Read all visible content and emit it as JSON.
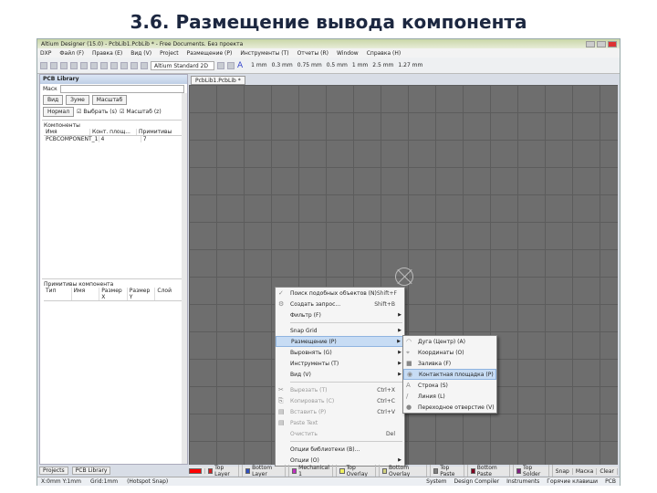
{
  "slide_title": "3.6. Размещение вывода компонента",
  "window_title": "Altium Designer (15.0) - PcbLib1.PcbLib * - Free Documents. Без проекта",
  "menu": [
    "DXP",
    "Файл (F)",
    "Правка (E)",
    "Вид (V)",
    "Project",
    "Размещение (P)",
    "Инструменты (T)",
    "Отчеты (R)",
    "Window",
    "Справка (H)"
  ],
  "toolbar": {
    "combo": "Altium Standard 2D",
    "units": [
      "1 mm",
      "0.3 mm",
      "0.75 mm",
      "0.5 mm",
      "1 mm",
      "2.5 mm",
      "1.27 mm"
    ]
  },
  "panel": {
    "title": "PCB Library",
    "mask_label": "Маск",
    "buttons": [
      "Вид",
      "Зуме",
      "Масштаб"
    ],
    "mode": "Нормал",
    "check1": "Выбрать (s)",
    "check2": "Масштаб (z)",
    "components": {
      "title": "Компоненты",
      "headers": [
        "Имя",
        "Конт. площ...",
        "Примитивы"
      ],
      "rows": [
        {
          "name": "PCBCOMPONENT_1",
          "pads": "4",
          "prims": "7"
        }
      ]
    },
    "primitives": {
      "title": "Примитивы компонента",
      "headers": [
        "Тип",
        "Имя",
        "Размер X",
        "Размер Y",
        "Слой"
      ]
    },
    "tabs": [
      "Projects",
      "PCB Library"
    ]
  },
  "doc_tab": "PcbLib1.PcbLib *",
  "context_menu": [
    {
      "label": "Поиск подобных объектов (N)",
      "shortcut": "Shift+F",
      "icon": "✓"
    },
    {
      "label": "Создать запрос...",
      "shortcut": "Shift+B",
      "icon": "⚙"
    },
    {
      "label": "Фильтр (F)",
      "sub": true
    },
    {
      "sep": true
    },
    {
      "label": "Snap Grid",
      "sub": true
    },
    {
      "label": "Размещение (P)",
      "sub": true,
      "hl": true
    },
    {
      "label": "Выровнять (G)",
      "sub": true
    },
    {
      "label": "Инструменты (T)",
      "sub": true
    },
    {
      "label": "Вид (V)",
      "sub": true
    },
    {
      "sep": true
    },
    {
      "label": "Вырезать (T)",
      "shortcut": "Ctrl+X",
      "dis": true,
      "icon": "✂"
    },
    {
      "label": "Копировать (C)",
      "shortcut": "Ctrl+C",
      "dis": true,
      "icon": "⎘"
    },
    {
      "label": "Вставить (P)",
      "shortcut": "Ctrl+V",
      "dis": true,
      "icon": "▤"
    },
    {
      "label": "Paste Text",
      "dis": true,
      "icon": "▤"
    },
    {
      "label": "Очистить",
      "shortcut": "Del",
      "dis": true
    },
    {
      "sep": true
    },
    {
      "label": "Опции библиотеки (B)..."
    },
    {
      "label": "Опции (O)",
      "sub": true
    }
  ],
  "submenu": [
    {
      "label": "Дуга (Центр) (A)",
      "icon": "◠"
    },
    {
      "label": "Координаты (O)",
      "icon": "⌖"
    },
    {
      "label": "Заливка (F)",
      "icon": "■"
    },
    {
      "label": "Контактная площадка (P)",
      "icon": "◉",
      "hl": true
    },
    {
      "label": "Строка (S)",
      "icon": "A"
    },
    {
      "label": "Линия (L)",
      "icon": "/"
    },
    {
      "label": "Переходное отверстие (V)",
      "icon": "●"
    }
  ],
  "layers": [
    {
      "name": "Top Layer",
      "color": "#d02020"
    },
    {
      "name": "Bottom Layer",
      "color": "#3050c0"
    },
    {
      "name": "Mechanical 1",
      "color": "#c030c0"
    },
    {
      "name": "Top Overlay",
      "color": "#f0f060"
    },
    {
      "name": "Bottom Overlay",
      "color": "#d0d080"
    },
    {
      "name": "Top Paste",
      "color": "#808080"
    },
    {
      "name": "Bottom Paste",
      "color": "#800020"
    },
    {
      "name": "Top Solder",
      "color": "#802080"
    }
  ],
  "layer_extra": [
    "Snap",
    "Маска",
    "Clear"
  ],
  "status": {
    "coords": "X:0mm Y:1mm",
    "grid": "Grid:1mm",
    "hotspot": "(Hotspot Snap)",
    "right": [
      "System",
      "Design Compiler",
      "Instruments",
      "Горячие клавиши",
      "PCB"
    ]
  }
}
